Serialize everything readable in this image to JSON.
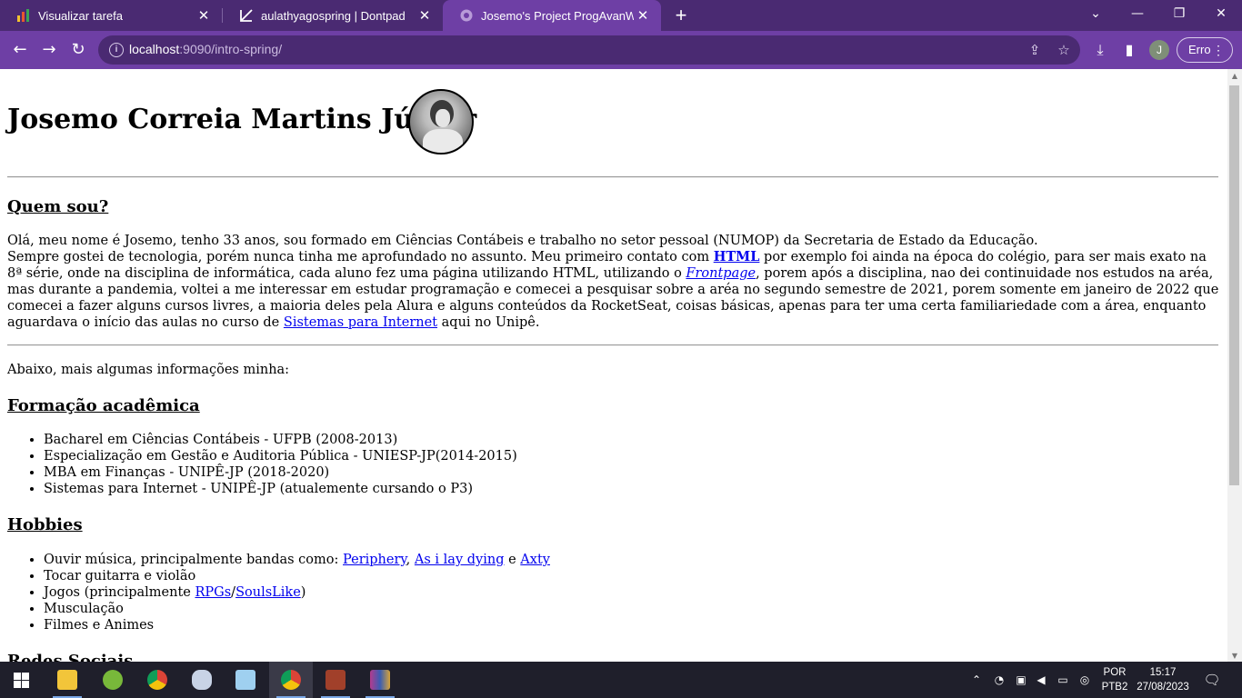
{
  "browser": {
    "tabs": [
      {
        "title": "Visualizar tarefa",
        "icon": "bar-chart-icon"
      },
      {
        "title": "aulathyagospring | Dontpad",
        "icon": "dontpad-icon"
      },
      {
        "title": "Josemo's Project ProgAvanWeb",
        "icon": "globe-icon"
      }
    ],
    "url_host": "localhost",
    "url_rest": ":9090/intro-spring/",
    "profile_initial": "J",
    "error_label": "Erro",
    "colors": {
      "frame": "#4a2a72",
      "toolbar": "#6e3fa5"
    }
  },
  "page": {
    "name": "Josemo Correia Martins Júnior",
    "about_heading": "Quem sou?",
    "about_lines": [
      {
        "pre": "Olá, meu nome é Josemo, tenho 33 anos, sou formado em Ciências Contábeis e trabalho no setor pessoal (NUMOP) da Secretaria de Estado da Educação."
      },
      {
        "pre": "Sempre gostei de tecnologia, porém nunca tinha me aprofundado no assunto. Meu primeiro contato com ",
        "link": "HTML",
        "post": " por exemplo foi ainda na época do colégio, para ser mais exato na"
      },
      {
        "pre": "8ª série, onde na disciplina de informática, cada aluno fez uma página utilizando HTML, utilizando o ",
        "link": "Frontpage",
        "post": ", porem após a disciplina, nao dei continuidade nos estudos na aréa,"
      },
      {
        "pre": "mas durante a pandemia, voltei a me interessar em estudar programação e comecei a pesquisar sobre a aréa no segundo semestre de 2021, porem somente em janeiro de 2022 que"
      },
      {
        "pre": "comecei a fazer alguns cursos livres, a maioria deles pela Alura e alguns conteúdos da RocketSeat, coisas básicas, apenas para ter uma certa familiariedade com a área, enquanto"
      },
      {
        "pre": "aguardava o início das aulas no curso de ",
        "link": "Sistemas para Internet",
        "post": " aqui no Unipê."
      }
    ],
    "more_info": "Abaixo, mais algumas informações minha:",
    "education_heading": "Formação acadêmica",
    "education": [
      "Bacharel em Ciências Contábeis - UFPB (2008-2013)",
      "Especialização em Gestão e Auditoria Pública - UNIESP-JP(2014-2015)",
      "MBA em Finanças - UNIPÊ-JP (2018-2020)",
      "Sistemas para Internet - UNIPÊ-JP (atualemente cursando o P3)"
    ],
    "hobbies_heading": "Hobbies",
    "hobbies": {
      "music_pre": "Ouvir música, principalmente bandas como: ",
      "band1": "Periphery",
      "sep1": ", ",
      "band2": "As i lay dying",
      "sep2": " e ",
      "band3": "Axty",
      "guitar": "Tocar guitarra e violão",
      "games_pre": "Jogos (principalmente ",
      "game1": "RPGs",
      "games_sep": "/",
      "game2": "SoulsLike",
      "games_post": ")",
      "gym": "Musculação",
      "movies": "Filmes e Animes"
    },
    "social_heading": "Redes Sociais"
  },
  "taskbar": {
    "apps": [
      "file-explorer-icon",
      "utorrent-icon",
      "chrome-icon",
      "paint-icon",
      "notepad-icon",
      "chrome-profile-icon",
      "game-icon",
      "winrar-icon"
    ],
    "lang_line1": "POR",
    "lang_line2": "PTB2",
    "time": "15:17",
    "date": "27/08/2023"
  }
}
